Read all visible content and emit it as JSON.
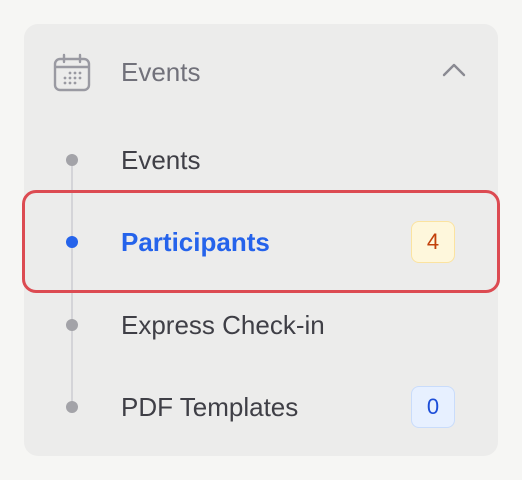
{
  "group": {
    "title": "Events",
    "icon": "calendar-icon",
    "chevron_icon": "chevron-up-icon"
  },
  "nav_items": [
    {
      "label": "Events",
      "active": false
    },
    {
      "label": "Participants",
      "active": true,
      "badge": "4",
      "badge_style": "warning"
    },
    {
      "label": "Express Check-in",
      "active": false
    },
    {
      "label": "PDF Templates",
      "active": false,
      "badge": "0",
      "badge_style": "info"
    }
  ],
  "colors": {
    "active": "#2563eb",
    "highlight_border": "#dc4b52",
    "warning_badge_text": "#c2410c",
    "info_badge_text": "#1d4ed8"
  }
}
